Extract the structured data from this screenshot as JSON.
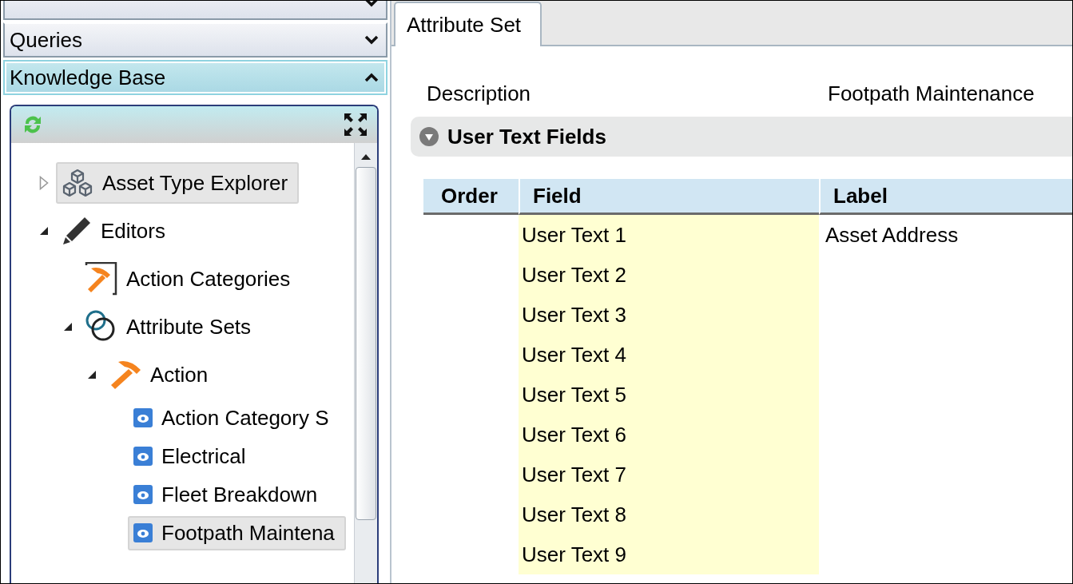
{
  "accordion": [
    {
      "expanded": false
    },
    {
      "title": "Queries",
      "expanded": false
    },
    {
      "title": "Knowledge Base",
      "expanded": true
    }
  ],
  "tree": [
    {
      "label": "Asset Type Explorer",
      "kind": "cubes",
      "expanded": false,
      "selected": true
    },
    {
      "label": "Editors",
      "kind": "pencil",
      "expanded": true,
      "selected": false,
      "children": [
        {
          "label": "Action Categories",
          "kind": "hammer-frame",
          "selected": false
        },
        {
          "label": "Attribute Sets",
          "kind": "rings",
          "expanded": true,
          "selected": false,
          "children": [
            {
              "label": "Action",
              "kind": "hammer",
              "expanded": true,
              "selected": false,
              "children": [
                {
                  "label": "Action Category S",
                  "kind": "eye",
                  "selected": false
                },
                {
                  "label": "Electrical",
                  "kind": "eye",
                  "selected": false
                },
                {
                  "label": "Fleet Breakdown",
                  "kind": "eye",
                  "selected": false
                },
                {
                  "label": "Footpath Maintena",
                  "kind": "eye",
                  "selected": true
                }
              ]
            }
          ]
        }
      ]
    }
  ],
  "tabs": [
    {
      "label": "Attribute Set",
      "selected": true
    }
  ],
  "description": {
    "label": "Description",
    "value": "Footpath Maintenance"
  },
  "section": {
    "title": "User Text Fields",
    "expanded": true
  },
  "table": {
    "columns": [
      "Order",
      "Field",
      "Label"
    ],
    "rows": [
      {
        "field": "User Text 1",
        "label": "Asset Address"
      },
      {
        "field": "User Text 2"
      },
      {
        "field": "User Text 3"
      },
      {
        "field": "User Text 4"
      },
      {
        "field": "User Text 5"
      },
      {
        "field": "User Text 6"
      },
      {
        "field": "User Text 7"
      },
      {
        "field": "User Text 8"
      },
      {
        "field": "User Text 9"
      }
    ]
  }
}
